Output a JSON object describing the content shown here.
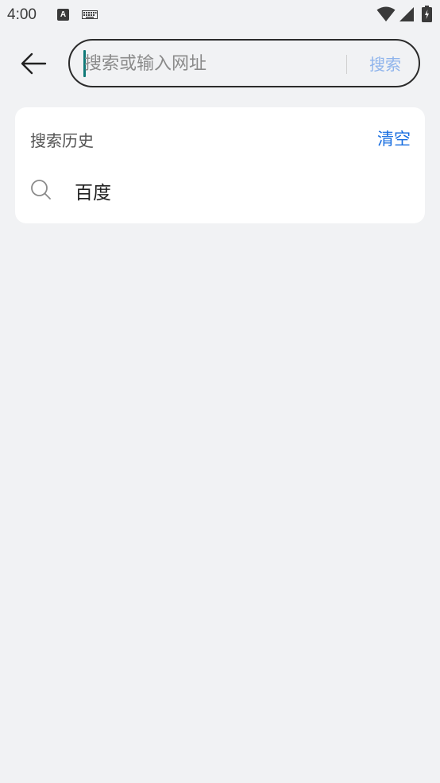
{
  "status_bar": {
    "time": "4:00",
    "notification_icon": "A",
    "icons": [
      "app-notification-icon",
      "keyboard-icon",
      "wifi-icon",
      "signal-icon",
      "battery-icon"
    ]
  },
  "header": {
    "back_icon": "arrow-left-icon",
    "search": {
      "placeholder": "搜索或输入网址",
      "value": ""
    },
    "search_button_label": "搜索"
  },
  "history": {
    "title": "搜索历史",
    "clear_label": "清空",
    "items": [
      {
        "label": "百度",
        "icon": "search-icon"
      }
    ]
  },
  "colors": {
    "background": "#f1f2f4",
    "accent": "#1a6fe0",
    "search_button_disabled": "#8fb4ec",
    "caret": "#107a78"
  }
}
